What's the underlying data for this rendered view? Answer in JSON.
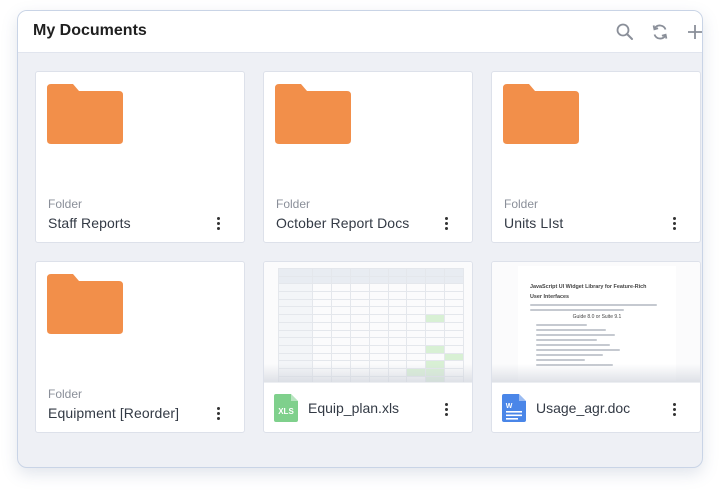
{
  "header": {
    "title": "My Documents",
    "icons": [
      "search-icon",
      "refresh-icon",
      "add-icon"
    ]
  },
  "cards": [
    {
      "type": "Folder",
      "name": "Staff Reports"
    },
    {
      "type": "Folder",
      "name": "October Report Docs"
    },
    {
      "type": "Folder",
      "name": "Units LIst"
    },
    {
      "type": "Folder",
      "name": "Equipment [Reorder]"
    },
    {
      "name": "Equip_plan.xls",
      "icon_label": "XLS",
      "icon_color": "#7fd08c"
    },
    {
      "name": "Usage_agr.doc",
      "icon_label": "W",
      "icon_color": "#4a86e8"
    }
  ],
  "doc_preview": {
    "title": "JavaScript UI Widget Library for Feature-Rich",
    "subtitle": "User Interfaces",
    "center_heading": "Guide 8.0 or Suite 9.1"
  },
  "colors": {
    "folder": "#f28f4a",
    "folder_tab": "#ee8440",
    "accent_border": "#c9d4e6"
  }
}
